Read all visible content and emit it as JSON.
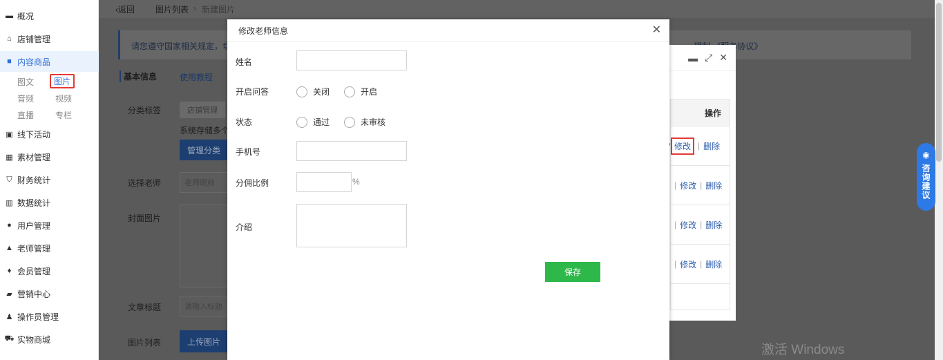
{
  "sidebar": {
    "items": [
      {
        "label": "概况",
        "icon": "overview-icon"
      },
      {
        "label": "店铺管理",
        "icon": "store-icon"
      },
      {
        "label": "内容商品",
        "icon": "bag-icon"
      },
      {
        "label": "线下活动",
        "icon": "event-icon"
      },
      {
        "label": "素材管理",
        "icon": "image-icon"
      },
      {
        "label": "财务统计",
        "icon": "shield-icon"
      },
      {
        "label": "数据统计",
        "icon": "bar-chart-icon"
      },
      {
        "label": "用户管理",
        "icon": "user-icon"
      },
      {
        "label": "老师管理",
        "icon": "graduation-cap-icon"
      },
      {
        "label": "会员管理",
        "icon": "vip-icon"
      },
      {
        "label": "营销中心",
        "icon": "trend-icon"
      },
      {
        "label": "操作员管理",
        "icon": "operator-icon"
      },
      {
        "label": "实物商城",
        "icon": "cart-icon"
      }
    ],
    "sub_items": [
      "图文",
      "图片",
      "音频",
      "视频",
      "直播",
      "专栏"
    ]
  },
  "background": {
    "breadcrumb": [
      "返回",
      "图片列表",
      "新建图片"
    ],
    "notice_text": "请您遵守国家相关规定，切",
    "notice_right": "相利  《服务协议》",
    "section_title": "基本信息",
    "tutorial_link": "使用教程",
    "category_label": "分类标签",
    "category_tag": "店铺管理",
    "category_hint": "系统存储多个",
    "manage_category_btn": "管理分类",
    "teacher_label": "选择老师",
    "teacher_placeholder": "老师昵称",
    "cover_label": "封面图片",
    "title_label": "文章标题",
    "title_placeholder": "请输入标题",
    "list_label": "图片列表",
    "upload_btn": "上传图片"
  },
  "back_dialog": {
    "header_col": "操作",
    "rows": [
      {
        "edit": "修改",
        "delete": "删除"
      },
      {
        "edit": "修改",
        "delete": "删除"
      },
      {
        "edit": "修改",
        "delete": "删除"
      },
      {
        "edit": "修改",
        "delete": "删除"
      }
    ]
  },
  "modal": {
    "title": "修改老师信息",
    "fields": {
      "name_label": "姓名",
      "name_value": "",
      "qa_label": "开启问答",
      "qa_options": [
        "关闭",
        "开启"
      ],
      "status_label": "状态",
      "status_options": [
        "通过",
        "未审核"
      ],
      "phone_label": "手机号",
      "phone_value": "",
      "commission_label": "分佣比例",
      "commission_unit": "%",
      "intro_label": "介绍",
      "intro_value": ""
    },
    "save_label": "保存"
  },
  "consult": {
    "label": "咨询建议"
  },
  "watermark": "激活 Windows",
  "colors": {
    "accent": "#2f6fd6",
    "save": "#2eb84a",
    "highlight": "#e53935"
  }
}
